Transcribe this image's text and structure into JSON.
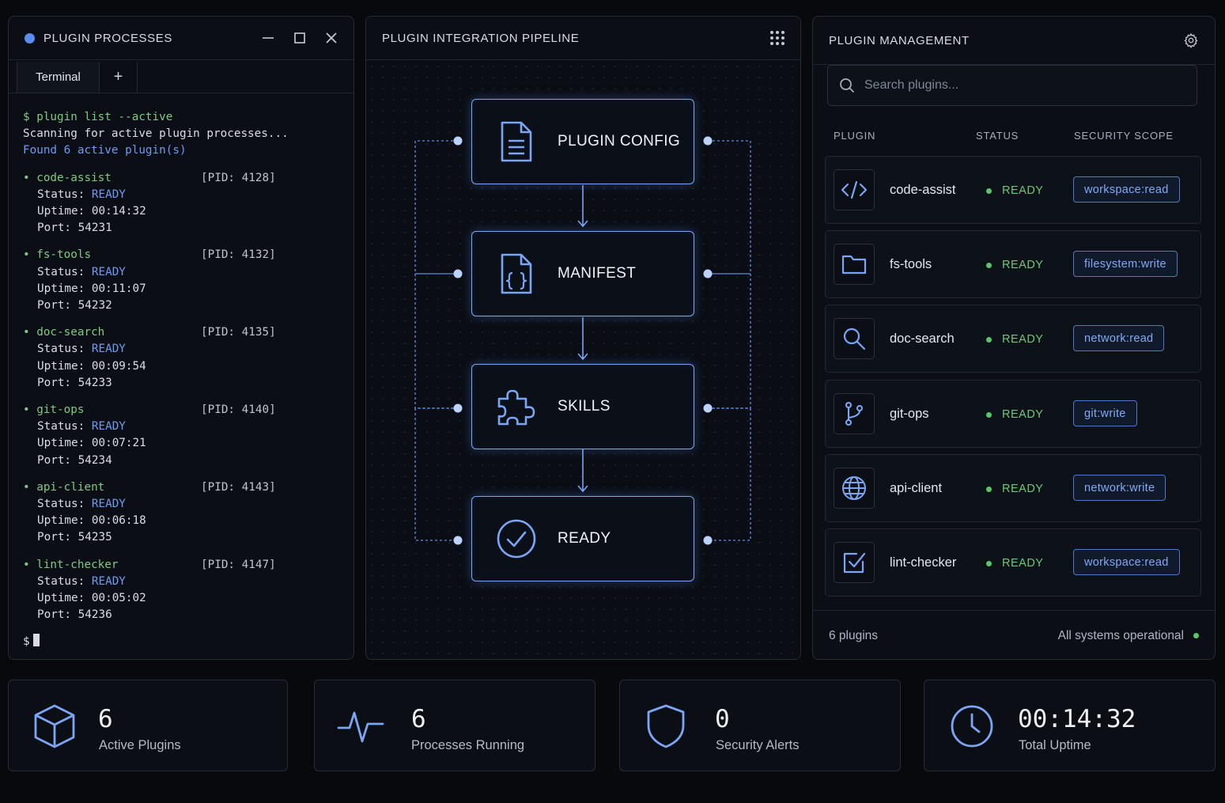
{
  "colors": {
    "accent": "#6f9bf2",
    "ready": "#6dc87a",
    "background": "#07090d"
  },
  "terminal": {
    "title": "PLUGIN PROCESSES",
    "tab_label": "Terminal",
    "tab_add_label": "+",
    "command": "$ plugin list --active",
    "scanning": "Scanning for active plugin processes...",
    "found": "Found 6 active plugin(s)",
    "status_label": "Status:",
    "uptime_label": "Uptime:",
    "port_label": "Port:",
    "prompt": "$",
    "processes": [
      {
        "name": "code-assist",
        "pid": "[PID: 4128]",
        "status": "READY",
        "uptime": "00:14:32",
        "port": "54231"
      },
      {
        "name": "fs-tools",
        "pid": "[PID: 4132]",
        "status": "READY",
        "uptime": "00:11:07",
        "port": "54232"
      },
      {
        "name": "doc-search",
        "pid": "[PID: 4135]",
        "status": "READY",
        "uptime": "00:09:54",
        "port": "54233"
      },
      {
        "name": "git-ops",
        "pid": "[PID: 4140]",
        "status": "READY",
        "uptime": "00:07:21",
        "port": "54234"
      },
      {
        "name": "api-client",
        "pid": "[PID: 4143]",
        "status": "READY",
        "uptime": "00:06:18",
        "port": "54235"
      },
      {
        "name": "lint-checker",
        "pid": "[PID: 4147]",
        "status": "READY",
        "uptime": "00:05:02",
        "port": "54236"
      }
    ]
  },
  "pipeline": {
    "title": "PLUGIN INTEGRATION PIPELINE",
    "stages": [
      {
        "label": "PLUGIN CONFIG",
        "icon": "file-icon"
      },
      {
        "label": "MANIFEST",
        "icon": "json-file-icon"
      },
      {
        "label": "SKILLS",
        "icon": "puzzle-icon"
      },
      {
        "label": "READY",
        "icon": "check-circle-icon"
      }
    ]
  },
  "management": {
    "title": "PLUGIN MANAGEMENT",
    "search_placeholder": "Search plugins...",
    "columns": {
      "plugin": "PLUGIN",
      "status": "STATUS",
      "scope": "SECURITY SCOPE"
    },
    "plugins": [
      {
        "name": "code-assist",
        "status": "READY",
        "scope": "workspace:read",
        "icon": "code-icon"
      },
      {
        "name": "fs-tools",
        "status": "READY",
        "scope": "filesystem:write",
        "icon": "folder-icon"
      },
      {
        "name": "doc-search",
        "status": "READY",
        "scope": "network:read",
        "icon": "search-icon"
      },
      {
        "name": "git-ops",
        "status": "READY",
        "scope": "git:write",
        "icon": "git-branch-icon"
      },
      {
        "name": "api-client",
        "status": "READY",
        "scope": "network:write",
        "icon": "globe-icon"
      },
      {
        "name": "lint-checker",
        "status": "READY",
        "scope": "workspace:read",
        "icon": "checkbox-icon"
      }
    ],
    "footer_count": "6 plugins",
    "footer_status": "All systems operational"
  },
  "stats": [
    {
      "value": "6",
      "label": "Active Plugins",
      "icon": "cube-icon"
    },
    {
      "value": "6",
      "label": "Processes Running",
      "icon": "activity-icon"
    },
    {
      "value": "0",
      "label": "Security Alerts",
      "icon": "shield-icon"
    },
    {
      "value": "00:14:32",
      "label": "Total Uptime",
      "icon": "clock-icon"
    }
  ]
}
